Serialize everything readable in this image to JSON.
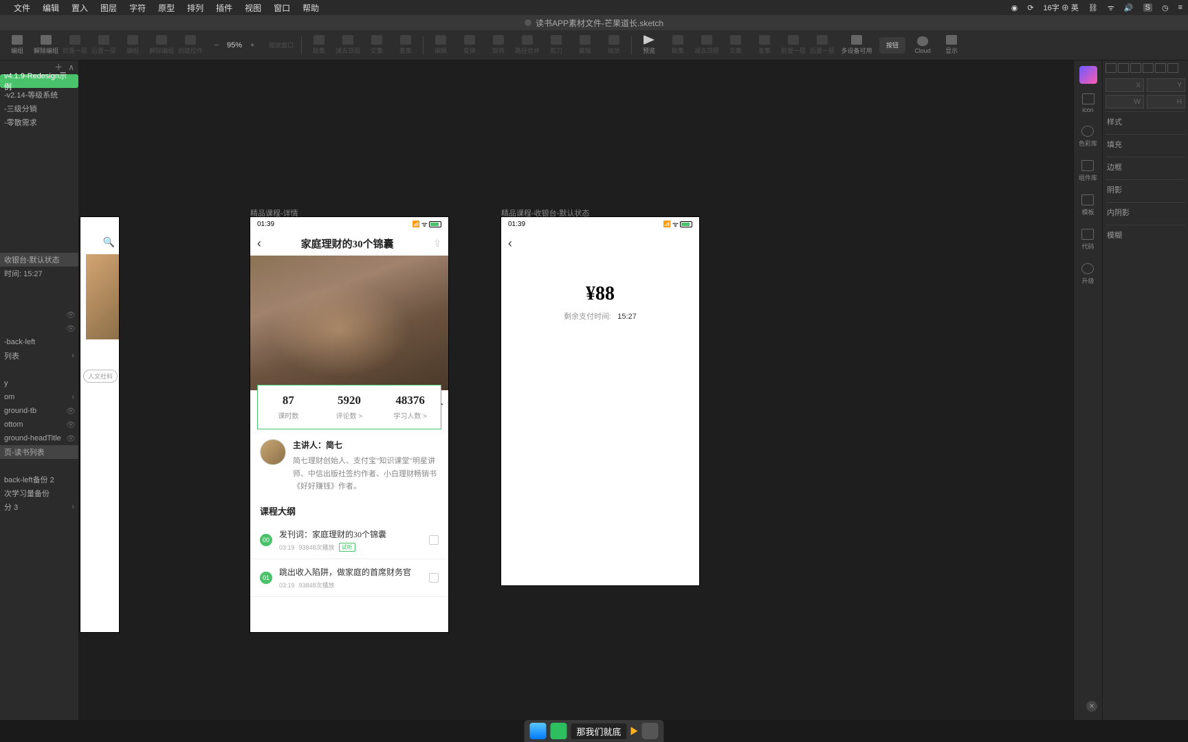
{
  "menubar": {
    "items": [
      "文件",
      "编辑",
      "置入",
      "图层",
      "字符",
      "原型",
      "排列",
      "插件",
      "视图",
      "窗口",
      "帮助"
    ],
    "status_input": "16字",
    "status_lang": "英"
  },
  "titlebar": {
    "filename": "读书APP素材文件-芒果道长.sketch"
  },
  "toolbar": {
    "items": [
      "编组",
      "解除编组",
      "前置一层",
      "后置一层",
      "编组",
      "解除编组",
      "创建控件"
    ],
    "zoom_minus": "−",
    "zoom": "95%",
    "zoom_plus": "+",
    "scale_label": "缩放窗口",
    "items2": [
      "联集",
      "减去顶层",
      "交集",
      "差集"
    ],
    "items3": [
      "编辑",
      "变换",
      "旋转",
      "路径合并",
      "剪刀",
      "蒙版",
      "缩放"
    ],
    "items4": [
      "预览",
      "联集",
      "减去顶层",
      "交集",
      "差集",
      "前置一层",
      "后置一层",
      "多设备可用",
      "Cloud",
      "显示"
    ],
    "btn_label": "按钮"
  },
  "left": {
    "add": "＋",
    "collapse": "∧",
    "layers": [
      {
        "t": "v4.1.9-Redesign示例",
        "sel": true
      },
      {
        "t": "-v2.14-等级系统"
      },
      {
        "t": "-三级分销"
      },
      {
        "t": "-零散需求"
      }
    ],
    "layers2": [
      {
        "t": "收银台-默认状态",
        "g": true
      },
      {
        "t": "时间: 15:27"
      },
      {
        "t": "",
        "vis": true
      },
      {
        "t": "",
        "vis": true
      },
      {
        "t": "-back-left"
      },
      {
        "t": "列表",
        "vis": true,
        "chev": true
      },
      {
        "t": "y",
        "chev": true
      },
      {
        "t": "om",
        "chev": true
      },
      {
        "t": "ground-tb",
        "vis": true
      },
      {
        "t": "ottom",
        "vis": true
      },
      {
        "t": "ground-headTitle",
        "vis": true
      },
      {
        "t": "页-读书列表",
        "g": true
      },
      {
        "t": "back-left备份 2"
      },
      {
        "t": "次学习量备份"
      },
      {
        "t": "分 3",
        "chev": true
      }
    ]
  },
  "artboards": {
    "ab1": {
      "search_icon": "search",
      "tag": "人文社科"
    },
    "ab2": {
      "label": "精品课程-详情",
      "time": "01:39",
      "title": "家庭理财的30个锦囊",
      "stats": [
        {
          "num": "87",
          "lab": "课时数"
        },
        {
          "num": "5920",
          "lab": "评论数 >"
        },
        {
          "num": "48376",
          "lab": "学习人数 >"
        }
      ],
      "presenter_label": "主讲人：简七",
      "presenter_desc": "简七理财创始人、支付宝\"知识课堂\"明星讲师、中信出版社签约作者、小白理财畅销书《好好赚钱》作者。",
      "outline_title": "课程大纲",
      "lessons": [
        {
          "n": "00",
          "t": "发刊词：家庭理财的30个锦囊",
          "d": "03:19",
          "p": "93848次播放",
          "trial": "试听"
        },
        {
          "n": "01",
          "t": "跳出收入陷阱，做家庭的首席财务官",
          "d": "03:19",
          "p": "93848次播放"
        }
      ]
    },
    "ab3": {
      "label": "精品课程-收银台-默认状态",
      "time": "01:39",
      "price": "¥88",
      "countdown_label": "剩余支付时间:",
      "countdown_time": "15:27"
    }
  },
  "right_tabs": [
    "icon",
    "色彩库",
    "组件库",
    "模板",
    "代码",
    "升级"
  ],
  "right_panel": {
    "coords": [
      "X",
      "Y",
      "W",
      "H"
    ],
    "sections": [
      "样式",
      "填充",
      "边框",
      "阴影",
      "内阴影",
      "模糊"
    ]
  },
  "dock": {
    "caption": "那我们就底"
  }
}
